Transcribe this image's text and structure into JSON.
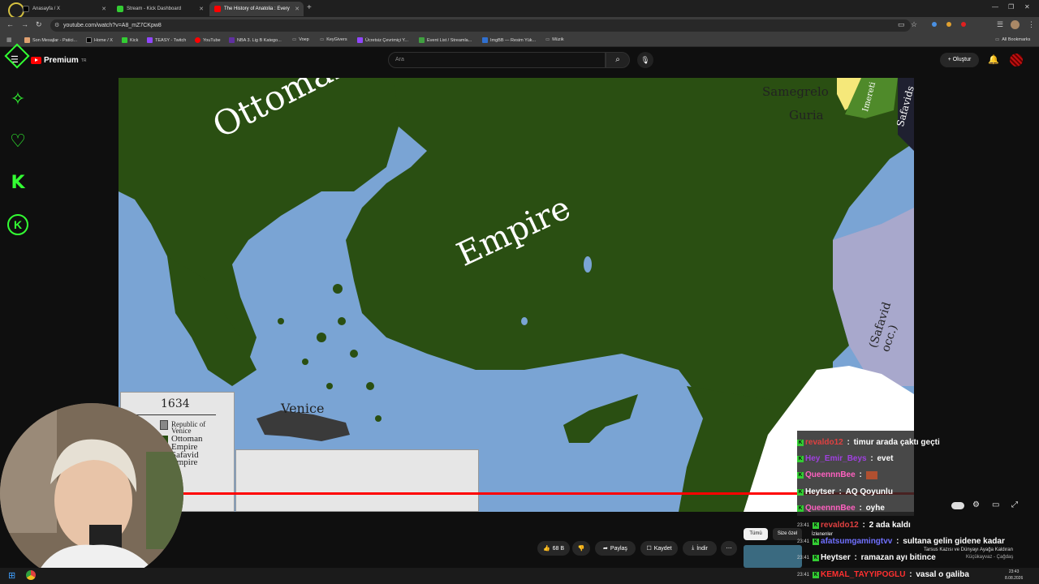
{
  "browser": {
    "tabs": [
      {
        "title": "Anasayfa / X"
      },
      {
        "title": "Stream - Kick Dashboard"
      },
      {
        "title": "The History of Anatolia : Every"
      }
    ],
    "new_tab": "+",
    "url": "youtube.com/watch?v=A8_mZ7CKpw8",
    "bookmarks": [
      "Son Mesajlar - Patici...",
      "Home / X",
      "Kick",
      "TEASY - Twitch",
      "YouTube",
      "NBA 3. Lig B Katego...",
      "Voep",
      "KeyGivers",
      "Ücretsiz Çevrimiçi Y...",
      "Event List / Streamla...",
      "ImgBB — Resim Yük...",
      "Müzik"
    ],
    "all_bookmarks": "All Bookmarks"
  },
  "youtube": {
    "logo_text": "Premium",
    "logo_sup": "TR",
    "search_placeholder": "Ara",
    "create_label": "Oluştur"
  },
  "map": {
    "labels": {
      "ottoman": "Ottoman",
      "empire": "Empire",
      "samegrelo": "Samegrelo",
      "guria": "Guria",
      "imereti": "Imereti",
      "safavids": "Safavids",
      "safavid_occ": "(Safavid occ.)",
      "venice": "Venice"
    },
    "year": "1634",
    "legend": [
      "Republic of",
      "Venice",
      "Ottoman",
      "Empire",
      "Safavid",
      "Empire"
    ]
  },
  "controls": {
    "like_count": "68 B",
    "share": "Paylaş",
    "save": "Kaydet",
    "download": "İndir",
    "filter_all": "Tümü",
    "filter_for_you": "Size özel",
    "watched": "İzlenenler"
  },
  "chat": [
    {
      "time": "",
      "user": "revaldo12",
      "user_color": "#e04040",
      "text": "timur arada çaktı geçti"
    },
    {
      "time": "",
      "user": "Hey_Emir_Beys",
      "user_color": "#a040e0",
      "text": "evet"
    },
    {
      "time": "",
      "user": "QueennnBee",
      "user_color": "#ff60c0",
      "text": ""
    },
    {
      "time": "",
      "user": "Heytser",
      "user_color": "#ffffff",
      "text": "AQ Qoyunlu"
    },
    {
      "time": "",
      "user": "QueennnBee",
      "user_color": "#ff60c0",
      "text": "oyhe"
    },
    {
      "time": "23:41",
      "user": "revaldo12",
      "user_color": "#e04040",
      "text": "2 ada kaldı"
    },
    {
      "time": "23:41",
      "user": "afatsumgamingtvv",
      "user_color": "#7070ff",
      "text": "sultana gelin gidene kadar"
    },
    {
      "time": "23:41",
      "user": "Heytser",
      "user_color": "#ffffff",
      "text": "ramazan ayı bitince"
    },
    {
      "time": "23:41",
      "user": "KEMAL_TAYYIPOGLU",
      "user_color": "#ff3030",
      "text": "vasal o galiba"
    }
  ],
  "recommend": {
    "title": "Tarsus Kazısı ve Dünyayı Ayağa Kaldıran",
    "channel": "Küçükayvaz - Çağdaş"
  },
  "clock": {
    "time": "23:43",
    "date": "8.08.2026"
  },
  "colors": {
    "ottoman": "#2a4f12",
    "sea": "#7aa4d4",
    "safavid": "#a8a8cc",
    "georgia": "#f5e87a",
    "venice": "#3a3a3a",
    "kick_green": "#33ff33",
    "yt_red": "#ff0000"
  }
}
